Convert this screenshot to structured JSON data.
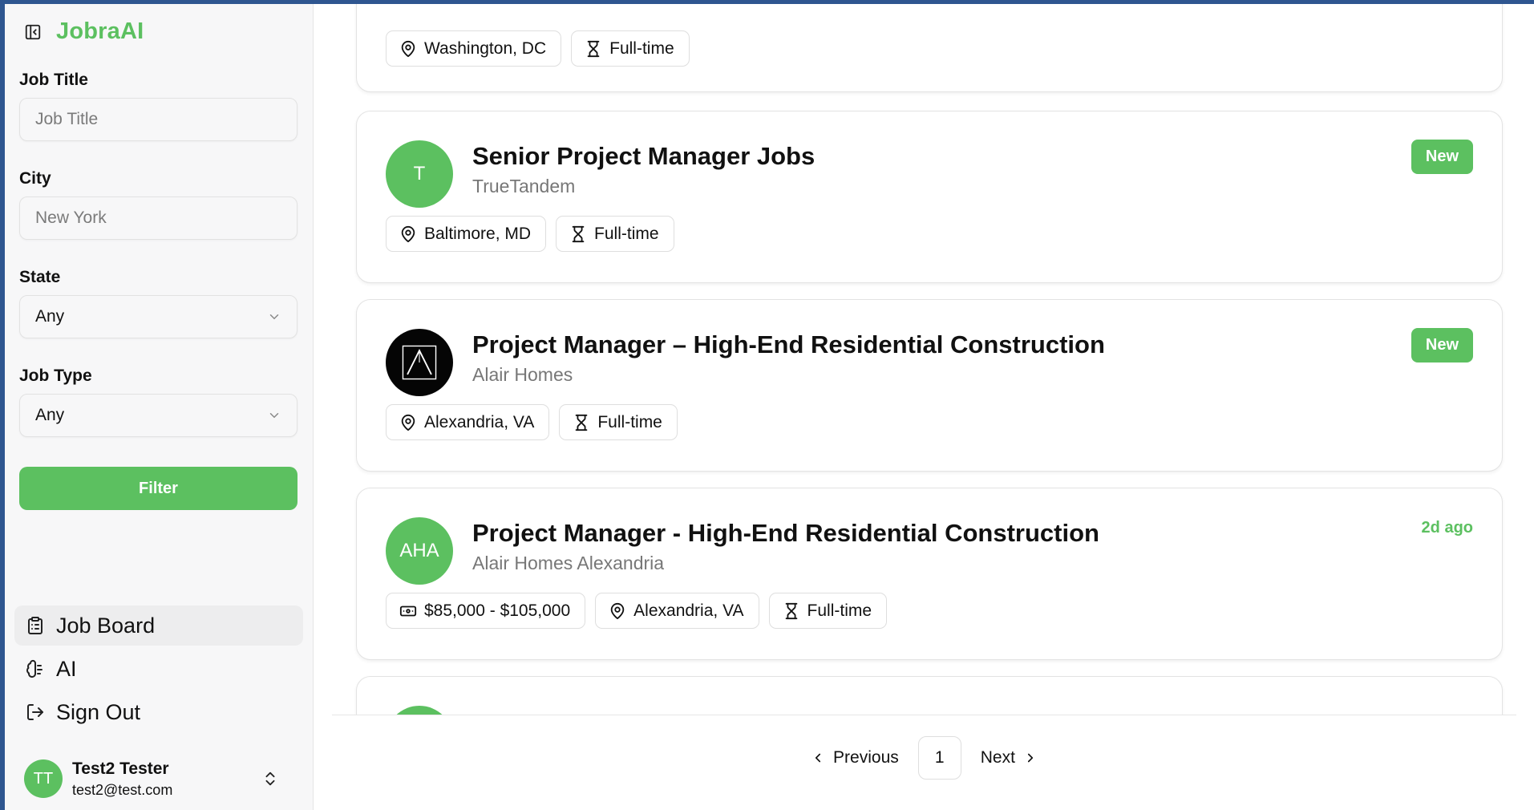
{
  "app": {
    "name": "JobraAI"
  },
  "filters": {
    "job_title": {
      "label": "Job Title",
      "placeholder": "Job Title",
      "value": ""
    },
    "city": {
      "label": "City",
      "placeholder": "New York",
      "value": ""
    },
    "state": {
      "label": "State",
      "value": "Any"
    },
    "job_type": {
      "label": "Job Type",
      "value": "Any"
    },
    "filter_button": "Filter"
  },
  "nav": [
    {
      "label": "Job Board",
      "icon": "clipboard-icon",
      "active": true
    },
    {
      "label": "AI",
      "icon": "brain-icon",
      "active": false
    },
    {
      "label": "Sign Out",
      "icon": "sign-out-icon",
      "active": false
    }
  ],
  "user": {
    "initials": "TT",
    "name": "Test2 Tester",
    "email": "test2@test.com"
  },
  "jobs": [
    {
      "location": "Washington, DC",
      "type": "Full-time"
    },
    {
      "logo": "T",
      "title": "Senior Project Manager Jobs",
      "company": "TrueTandem",
      "badge": "New",
      "location": "Baltimore, MD",
      "type": "Full-time"
    },
    {
      "logo": "",
      "title": "Project Manager – High-End Residential Construction",
      "company": "Alair Homes",
      "badge": "New",
      "location": "Alexandria, VA",
      "type": "Full-time"
    },
    {
      "logo": "AHA",
      "title": "Project Manager - High-End Residential Construction",
      "company": "Alair Homes Alexandria",
      "age": "2d ago",
      "salary": "$85,000 - $105,000",
      "location": "Alexandria, VA",
      "type": "Full-time"
    }
  ],
  "pagination": {
    "previous": "Previous",
    "page": "1",
    "next": "Next"
  },
  "colors": {
    "accent": "#5cc060",
    "frame": "#2f5690"
  }
}
